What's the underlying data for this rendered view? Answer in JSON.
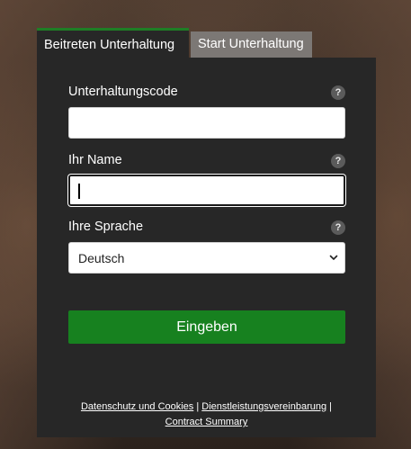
{
  "tabs": {
    "join_label": "Beitreten Unterhaltung",
    "start_label": "Start Unterhaltung"
  },
  "form": {
    "code_label": "Unterhaltungscode",
    "code_value": "",
    "name_label": "Ihr Name",
    "name_value": "",
    "language_label": "Ihre Sprache",
    "language_selected": "Deutsch",
    "help_glyph": "?",
    "submit_label": "Eingeben"
  },
  "footer": {
    "privacy_link": "Datenschutz und Cookies",
    "separator": "|",
    "service_link": "Dienstleistungsvereinbarung",
    "contract_link": "Contract Summary"
  },
  "colors": {
    "accent": "#17811f",
    "panel": "#272727",
    "inactive_tab": "#7c7875"
  },
  "icons": {
    "help": "help-icon",
    "dropdown": "chevron-down-icon"
  }
}
